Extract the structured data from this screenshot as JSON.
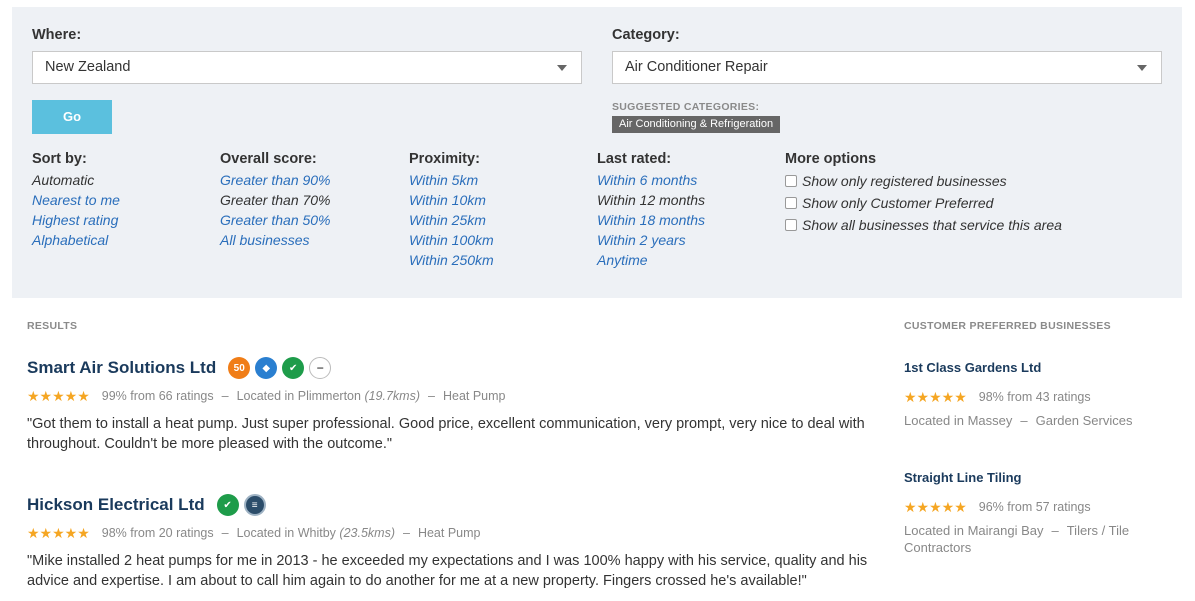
{
  "search": {
    "where_label": "Where:",
    "where_value": "New Zealand",
    "category_label": "Category:",
    "category_value": "Air Conditioner Repair",
    "go_label": "Go",
    "suggested_label": "SUGGESTED CATEGORIES:",
    "suggested_tag": "Air Conditioning & Refrigeration"
  },
  "filters": {
    "sort": {
      "heading": "Sort by:",
      "options": [
        "Automatic",
        "Nearest to me",
        "Highest rating",
        "Alphabetical"
      ]
    },
    "score": {
      "heading": "Overall score:",
      "options": [
        "Greater than 90%",
        "Greater than 70%",
        "Greater than 50%",
        "All businesses"
      ]
    },
    "proximity": {
      "heading": "Proximity:",
      "options": [
        "Within 5km",
        "Within 10km",
        "Within 25km",
        "Within 100km",
        "Within 250km"
      ]
    },
    "rated": {
      "heading": "Last rated:",
      "options": [
        "Within 6 months",
        "Within 12 months",
        "Within 18 months",
        "Within 2 years",
        "Anytime"
      ]
    },
    "more": {
      "heading": "More options",
      "options": [
        "Show only registered businesses",
        "Show only Customer Preferred",
        "Show all businesses that service this area"
      ]
    }
  },
  "results": {
    "label": "RESULTS",
    "items": [
      {
        "name": "Smart Air Solutions Ltd",
        "stars": "★★★★★",
        "rating": "99% from 66 ratings",
        "location": "Located in Plimmerton",
        "distance": "(19.7kms)",
        "category": "Heat Pump",
        "review": "\"Got them to install a heat pump. Just super professional. Good price, excellent communication, very prompt, very nice to deal with throughout. Couldn't be more pleased with the outcome.\""
      },
      {
        "name": "Hickson Electrical Ltd",
        "stars": "★★★★★",
        "rating": "98% from 20 ratings",
        "location": "Located in Whitby",
        "distance": "(23.5kms)",
        "category": "Heat Pump",
        "review": "\"Mike installed 2 heat pumps for me in 2013 - he exceeded my expectations and I was 100% happy with his service, quality and his advice and expertise. I am about to call him again to do another for me at a new property. Fingers crossed he's available!\""
      }
    ]
  },
  "preferred": {
    "label": "CUSTOMER PREFERRED BUSINESSES",
    "items": [
      {
        "name": "1st Class Gardens Ltd",
        "stars": "★★★★★",
        "rating": "98% from 43 ratings",
        "location": "Located in Massey",
        "category": "Garden Services"
      },
      {
        "name": "Straight Line Tiling",
        "stars": "★★★★★",
        "rating": "96% from 57 ratings",
        "location": "Located in Mairangi Bay",
        "category": "Tilers / Tile Contractors"
      }
    ]
  },
  "colors": {
    "link": "#2a6ebb",
    "go_button": "#5bc0de",
    "star": "#f5a623",
    "business_name": "#1a3a5c"
  }
}
